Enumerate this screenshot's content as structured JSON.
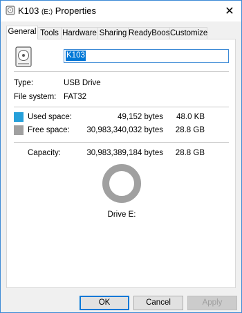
{
  "window": {
    "title": "K103",
    "title_drive": "(E:)",
    "title_suffix": "Properties",
    "close_glyph": "✕"
  },
  "tabs": [
    {
      "label": "General",
      "active": true
    },
    {
      "label": "Tools"
    },
    {
      "label": "Hardware"
    },
    {
      "label": "Sharing"
    },
    {
      "label": "ReadyBoost"
    },
    {
      "label": "Customize"
    }
  ],
  "general": {
    "name_value": "K103",
    "type_label": "Type:",
    "type_value": "USB Drive",
    "fs_label": "File system:",
    "fs_value": "FAT32",
    "used": {
      "label": "Used space:",
      "bytes": "49,152 bytes",
      "human": "48.0 KB",
      "color": "#26a0da"
    },
    "free": {
      "label": "Free space:",
      "bytes": "30,983,340,032 bytes",
      "human": "28.8 GB",
      "color": "#a0a0a0"
    },
    "capacity": {
      "label": "Capacity:",
      "bytes": "30,983,389,184 bytes",
      "human": "28.8 GB"
    },
    "drive_label": "Drive E:"
  },
  "buttons": {
    "ok": "OK",
    "cancel": "Cancel",
    "apply": "Apply"
  }
}
